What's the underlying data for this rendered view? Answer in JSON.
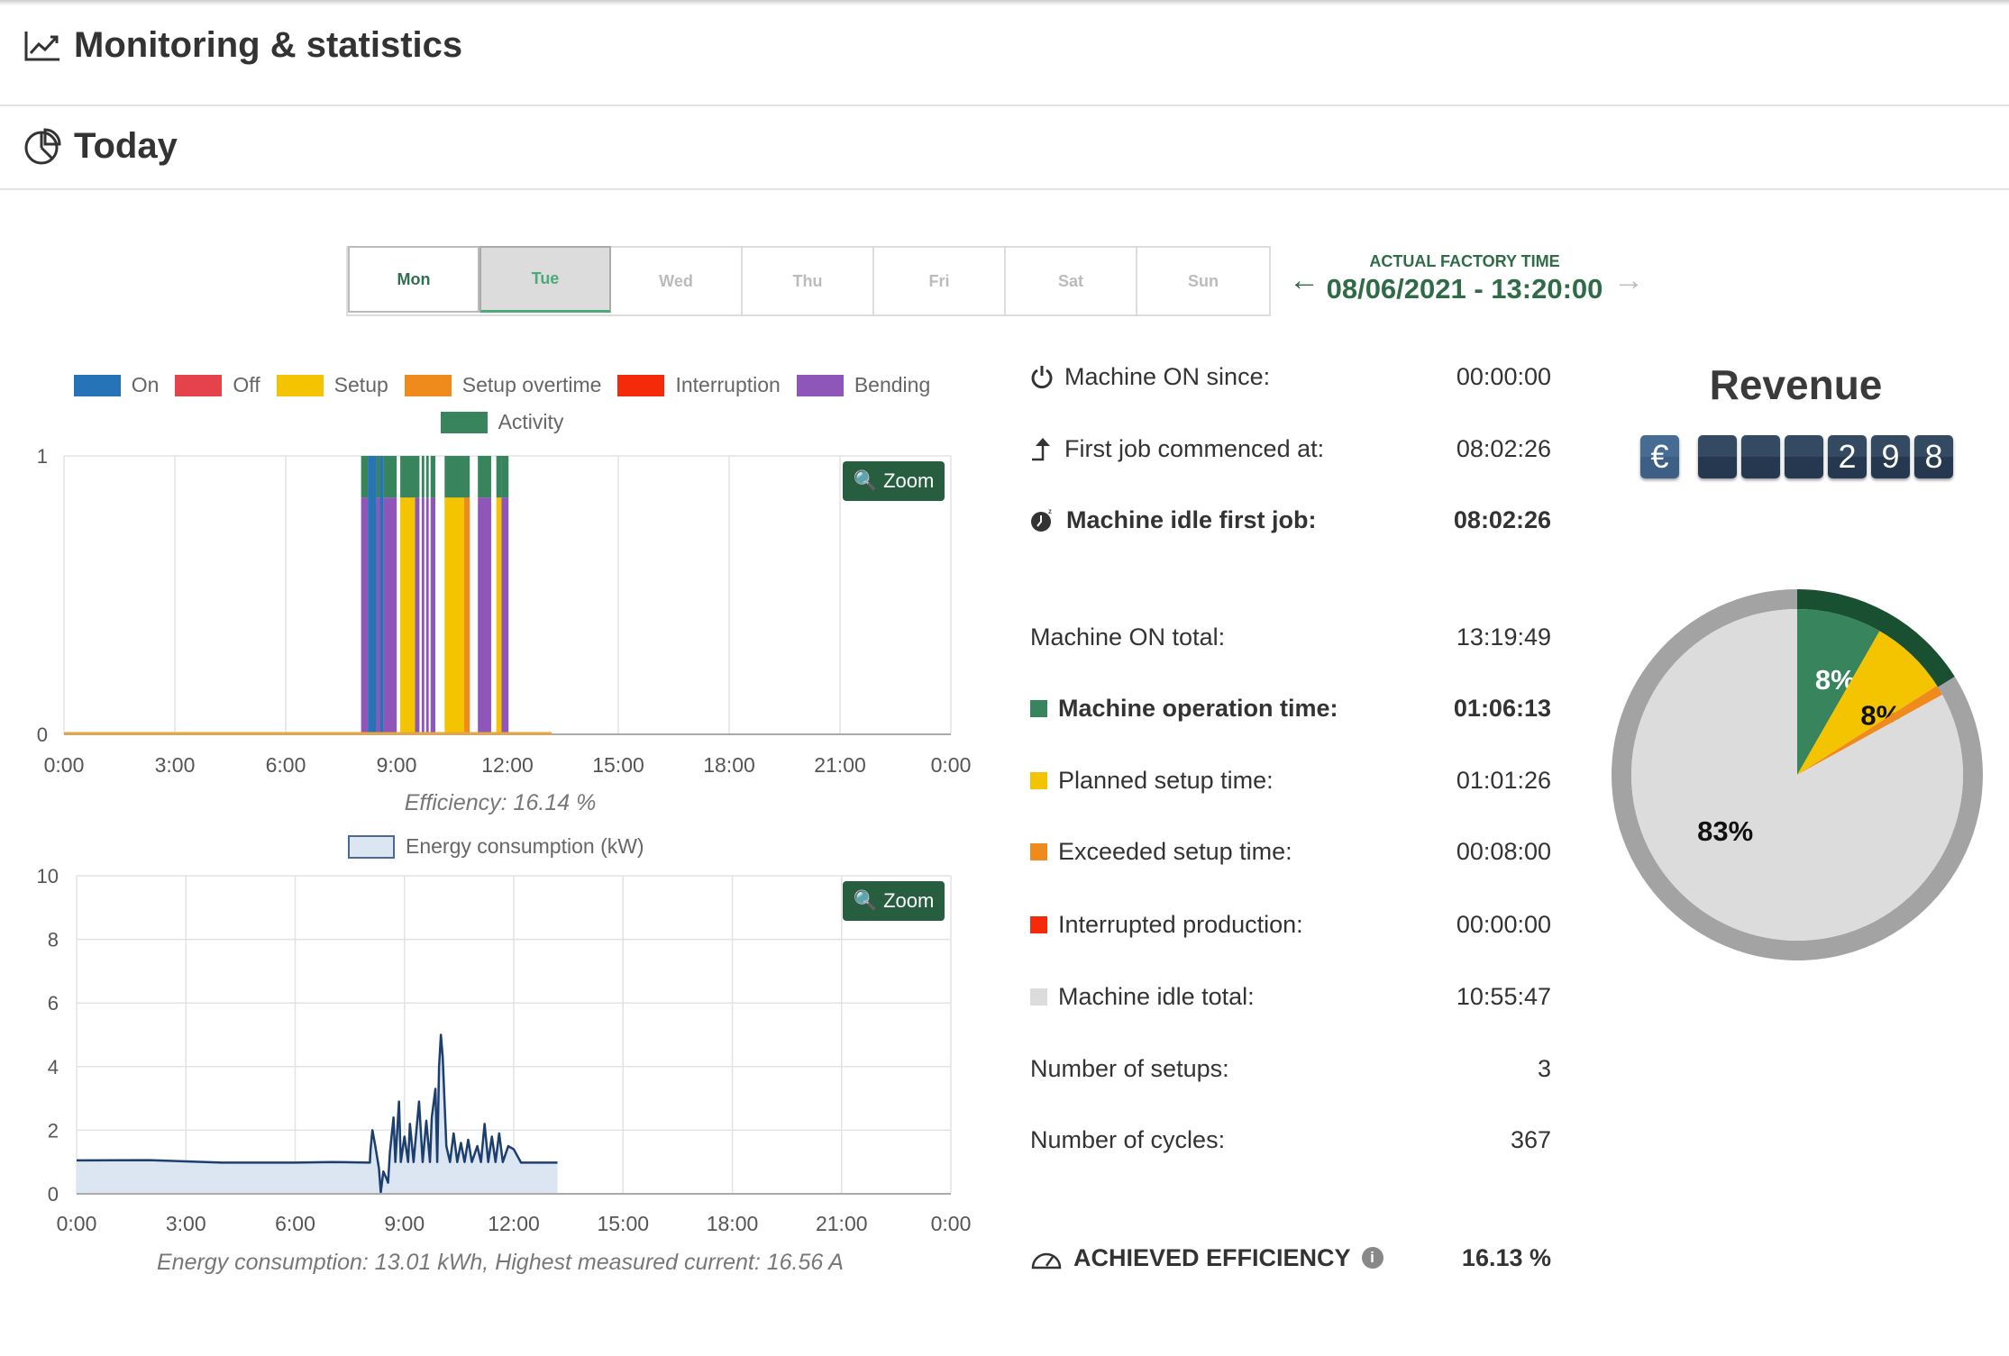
{
  "header": {
    "title": "Monitoring & statistics",
    "icon": "line-chart-icon"
  },
  "section": {
    "title": "Today",
    "icon": "pie-chart-icon"
  },
  "days": [
    {
      "label": "Mon",
      "state": "available"
    },
    {
      "label": "Tue",
      "state": "selected"
    },
    {
      "label": "Wed",
      "state": "disabled"
    },
    {
      "label": "Thu",
      "state": "disabled"
    },
    {
      "label": "Fri",
      "state": "disabled"
    },
    {
      "label": "Sat",
      "state": "disabled"
    },
    {
      "label": "Sun",
      "state": "disabled"
    }
  ],
  "factory_time": {
    "label": "ACTUAL FACTORY TIME",
    "value": "08/06/2021 - 13:20:00"
  },
  "zoom_label": "Zoom",
  "chart_data": [
    {
      "type": "bar",
      "legend": [
        {
          "name": "On",
          "color": "#2673b8"
        },
        {
          "name": "Off",
          "color": "#e5434b"
        },
        {
          "name": "Setup",
          "color": "#f5c400"
        },
        {
          "name": "Setup overtime",
          "color": "#ef8a1d"
        },
        {
          "name": "Interruption",
          "color": "#f52a0a"
        },
        {
          "name": "Bending",
          "color": "#8e56b8"
        },
        {
          "name": "Activity",
          "color": "#38855d"
        }
      ],
      "ylim": [
        0,
        1
      ],
      "yticks": [
        "0",
        "1"
      ],
      "xlim": [
        0,
        24
      ],
      "xticks": [
        "0:00",
        "3:00",
        "6:00",
        "9:00",
        "12:00",
        "15:00",
        "18:00",
        "21:00",
        "0:00"
      ],
      "segments": [
        {
          "start": 8.04,
          "end": 8.23,
          "state": "Bending",
          "activity": true
        },
        {
          "start": 8.23,
          "end": 8.45,
          "state": "On",
          "activity": false
        },
        {
          "start": 8.45,
          "end": 8.55,
          "state": "Bending",
          "activity": true
        },
        {
          "start": 8.55,
          "end": 8.65,
          "state": "On",
          "activity": false
        },
        {
          "start": 8.65,
          "end": 9.0,
          "state": "Bending",
          "activity": true
        },
        {
          "start": 9.1,
          "end": 9.5,
          "state": "Setup",
          "activity": true
        },
        {
          "start": 9.5,
          "end": 9.62,
          "state": "Bending",
          "activity": true
        },
        {
          "start": 9.68,
          "end": 9.75,
          "state": "Bending",
          "activity": true
        },
        {
          "start": 9.8,
          "end": 9.87,
          "state": "Bending",
          "activity": true
        },
        {
          "start": 9.92,
          "end": 10.05,
          "state": "Bending",
          "activity": true
        },
        {
          "start": 10.3,
          "end": 10.83,
          "state": "Setup",
          "activity": true
        },
        {
          "start": 10.83,
          "end": 10.98,
          "state": "Setup overtime",
          "activity": true
        },
        {
          "start": 11.2,
          "end": 11.56,
          "state": "Bending",
          "activity": true
        },
        {
          "start": 11.7,
          "end": 11.84,
          "state": "Setup",
          "activity": true
        },
        {
          "start": 11.84,
          "end": 12.03,
          "state": "Bending",
          "activity": true
        }
      ],
      "baseline_until": 13.2,
      "caption": "Efficiency: 16.14 %"
    },
    {
      "type": "area",
      "series": [
        {
          "name": "Energy consumption (kW)",
          "color": "#1c3f6e",
          "fill": "#dce5f2"
        }
      ],
      "ylim": [
        0,
        10
      ],
      "yticks": [
        "0",
        "2",
        "4",
        "6",
        "8",
        "10"
      ],
      "xlim": [
        0,
        24
      ],
      "xticks": [
        "0:00",
        "3:00",
        "6:00",
        "9:00",
        "12:00",
        "15:00",
        "18:00",
        "21:00",
        "0:00"
      ],
      "points": [
        [
          0,
          1.05
        ],
        [
          2,
          1.06
        ],
        [
          3,
          1.02
        ],
        [
          4,
          0.98
        ],
        [
          6,
          0.98
        ],
        [
          7,
          1.0
        ],
        [
          8.05,
          0.98
        ],
        [
          8.07,
          1.4
        ],
        [
          8.12,
          2.0
        ],
        [
          8.2,
          1.5
        ],
        [
          8.3,
          0.8
        ],
        [
          8.35,
          0.05
        ],
        [
          8.42,
          0.7
        ],
        [
          8.5,
          0.5
        ],
        [
          8.55,
          0.35
        ],
        [
          8.6,
          1.3
        ],
        [
          8.7,
          2.4
        ],
        [
          8.75,
          1.0
        ],
        [
          8.85,
          2.9
        ],
        [
          8.9,
          1.0
        ],
        [
          9.0,
          1.8
        ],
        [
          9.1,
          1.0
        ],
        [
          9.15,
          2.2
        ],
        [
          9.25,
          1.0
        ],
        [
          9.4,
          2.9
        ],
        [
          9.5,
          1.0
        ],
        [
          9.6,
          2.3
        ],
        [
          9.7,
          1.0
        ],
        [
          9.75,
          2.4
        ],
        [
          9.85,
          3.3
        ],
        [
          9.9,
          1.0
        ],
        [
          9.95,
          4.0
        ],
        [
          10.0,
          5.0
        ],
        [
          10.05,
          4.3
        ],
        [
          10.15,
          1.5
        ],
        [
          10.25,
          1.0
        ],
        [
          10.35,
          1.9
        ],
        [
          10.45,
          1.0
        ],
        [
          10.55,
          1.6
        ],
        [
          10.65,
          1.0
        ],
        [
          10.75,
          1.7
        ],
        [
          10.85,
          1.0
        ],
        [
          11.0,
          1.5
        ],
        [
          11.1,
          1.0
        ],
        [
          11.2,
          2.2
        ],
        [
          11.3,
          1.0
        ],
        [
          11.4,
          1.8
        ],
        [
          11.5,
          1.0
        ],
        [
          11.6,
          1.9
        ],
        [
          11.7,
          1.0
        ],
        [
          11.85,
          1.5
        ],
        [
          12.0,
          1.4
        ],
        [
          12.2,
          0.98
        ],
        [
          13.2,
          0.98
        ]
      ],
      "caption": "Energy consumption: 13.01 kWh, Highest measured current: 16.56 A"
    },
    {
      "type": "pie",
      "slices": [
        {
          "label": "8%",
          "value": 8.28,
          "color": "#38855d"
        },
        {
          "label": "8%",
          "value": 7.68,
          "color": "#f5c400"
        },
        {
          "label": "",
          "value": 1.0,
          "color": "#ef8a1d"
        },
        {
          "label": "83%",
          "value": 83.04,
          "color": "#dcdcdc"
        }
      ],
      "ring": {
        "value": 16.13,
        "color": "#1a5032",
        "rest_color": "#a3a3a3"
      }
    }
  ],
  "stats": [
    {
      "label": "Machine ON since:",
      "value": "00:00:00",
      "icon": "power-icon",
      "bold": false
    },
    {
      "label": "First job commenced at:",
      "value": "08:02:26",
      "icon": "arrow-up-turn-icon",
      "bold": false
    },
    {
      "label": "Machine idle first job:",
      "value": "08:02:26",
      "icon": "sleeping-clock-icon",
      "bold": true
    },
    {
      "label": "Machine ON total:",
      "value": "13:19:49",
      "bold": false
    },
    {
      "label": "Machine operation time:",
      "value": "01:06:13",
      "color": "#38855d",
      "bold": true
    },
    {
      "label": "Planned setup time:",
      "value": "01:01:26",
      "color": "#f5c400",
      "bold": false
    },
    {
      "label": "Exceeded setup time:",
      "value": "00:08:00",
      "color": "#ef8a1d",
      "bold": false
    },
    {
      "label": "Interrupted production:",
      "value": "00:00:00",
      "color": "#f52a0a",
      "bold": false
    },
    {
      "label": "Machine idle total:",
      "value": "10:55:47",
      "color": "#dcdcdc",
      "bold": false
    },
    {
      "label": "Number of setups:",
      "value": "3",
      "bold": false
    },
    {
      "label": "Number of cycles:",
      "value": "367",
      "bold": false
    }
  ],
  "efficiency": {
    "label": "ACHIEVED EFFICIENCY",
    "value": "16.13 %",
    "icon": "gauge-icon",
    "info_icon": "info-icon"
  },
  "revenue": {
    "title": "Revenue",
    "currency": "€",
    "digits": [
      "",
      "",
      "",
      "2",
      "9",
      "8"
    ]
  }
}
